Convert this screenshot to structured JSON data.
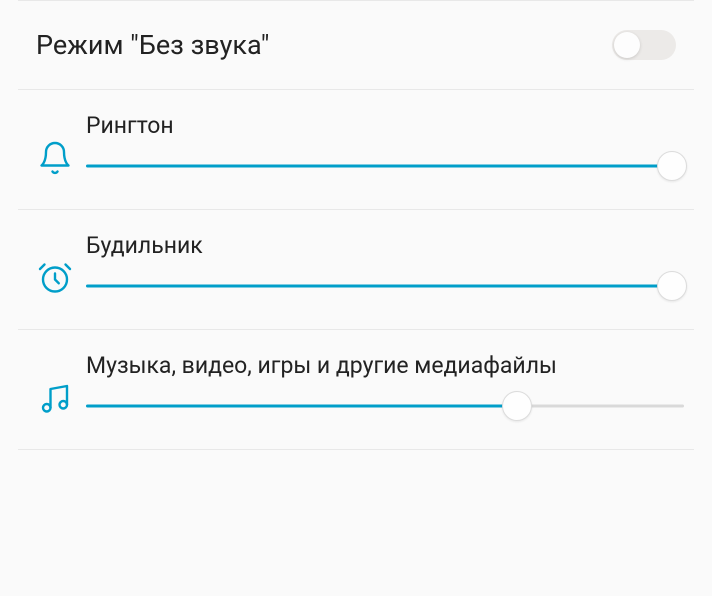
{
  "silentMode": {
    "label": "Режим \"Без звука\"",
    "enabled": false
  },
  "sliders": {
    "ringtone": {
      "label": "Рингтон",
      "value": 100
    },
    "alarm": {
      "label": "Будильник",
      "value": 100
    },
    "media": {
      "label": "Музыка, видео, игры и другие медиафайлы",
      "value": 72
    }
  },
  "colors": {
    "accent": "#009ec9",
    "divider": "#e8e8e8",
    "text": "#222"
  }
}
